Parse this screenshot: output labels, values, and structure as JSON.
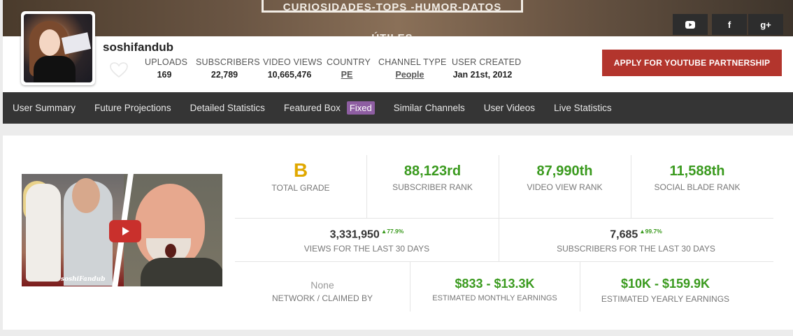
{
  "banner": {
    "text": "CURIOSIDADES-TOPS -HUMOR-DATOS ÚTILES",
    "social_icons": [
      "youtube-icon",
      "facebook-icon",
      "google-plus-icon"
    ],
    "facebook_glyph": "f",
    "gplus_glyph": "g+"
  },
  "profile": {
    "username": "soshifandub",
    "stats": [
      {
        "label": "UPLOADS",
        "value": "169"
      },
      {
        "label": "SUBSCRIBERS",
        "value": "22,789"
      },
      {
        "label": "VIDEO VIEWS",
        "value": "10,665,476"
      },
      {
        "label": "COUNTRY",
        "value": "PE"
      },
      {
        "label": "CHANNEL TYPE",
        "value": "People"
      },
      {
        "label": "USER CREATED",
        "value": "Jan 21st, 2012"
      }
    ],
    "apply_button": "APPLY FOR YOUTUBE PARTNERSHIP"
  },
  "nav": {
    "items": [
      "User Summary",
      "Future Projections",
      "Detailed Statistics",
      "Featured Box",
      "Similar Channels",
      "User Videos",
      "Live Statistics"
    ],
    "featured_badge": "Fixed"
  },
  "summary": {
    "video_watermark": "soshiFandub",
    "grade": {
      "value": "B",
      "label": "TOTAL GRADE"
    },
    "subscriber_rank": {
      "value": "88,123rd",
      "label": "SUBSCRIBER RANK"
    },
    "video_view_rank": {
      "value": "87,990th",
      "label": "VIDEO VIEW RANK"
    },
    "social_blade_rank": {
      "value": "11,588th",
      "label": "SOCIAL BLADE RANK"
    },
    "views_30": {
      "value": "3,331,950",
      "change": "▲77.9%",
      "label": "VIEWS FOR THE LAST 30 DAYS"
    },
    "subs_30": {
      "value": "7,685",
      "change": "▲99.7%",
      "label": "SUBSCRIBERS FOR THE LAST 30 DAYS"
    },
    "network": {
      "value": "None",
      "label": "NETWORK / CLAIMED BY"
    },
    "monthly": {
      "value": "$833 - $13.3K",
      "label": "ESTIMATED MONTHLY EARNINGS"
    },
    "yearly": {
      "value": "$10K - $159.9K",
      "label": "ESTIMATED YEARLY EARNINGS"
    }
  },
  "colors": {
    "accent_green": "#3a9a1e",
    "grade_gold": "#e0a800",
    "apply_red": "#b3352d",
    "nav_bg": "#353535",
    "badge_purple": "#8e5ea2"
  }
}
